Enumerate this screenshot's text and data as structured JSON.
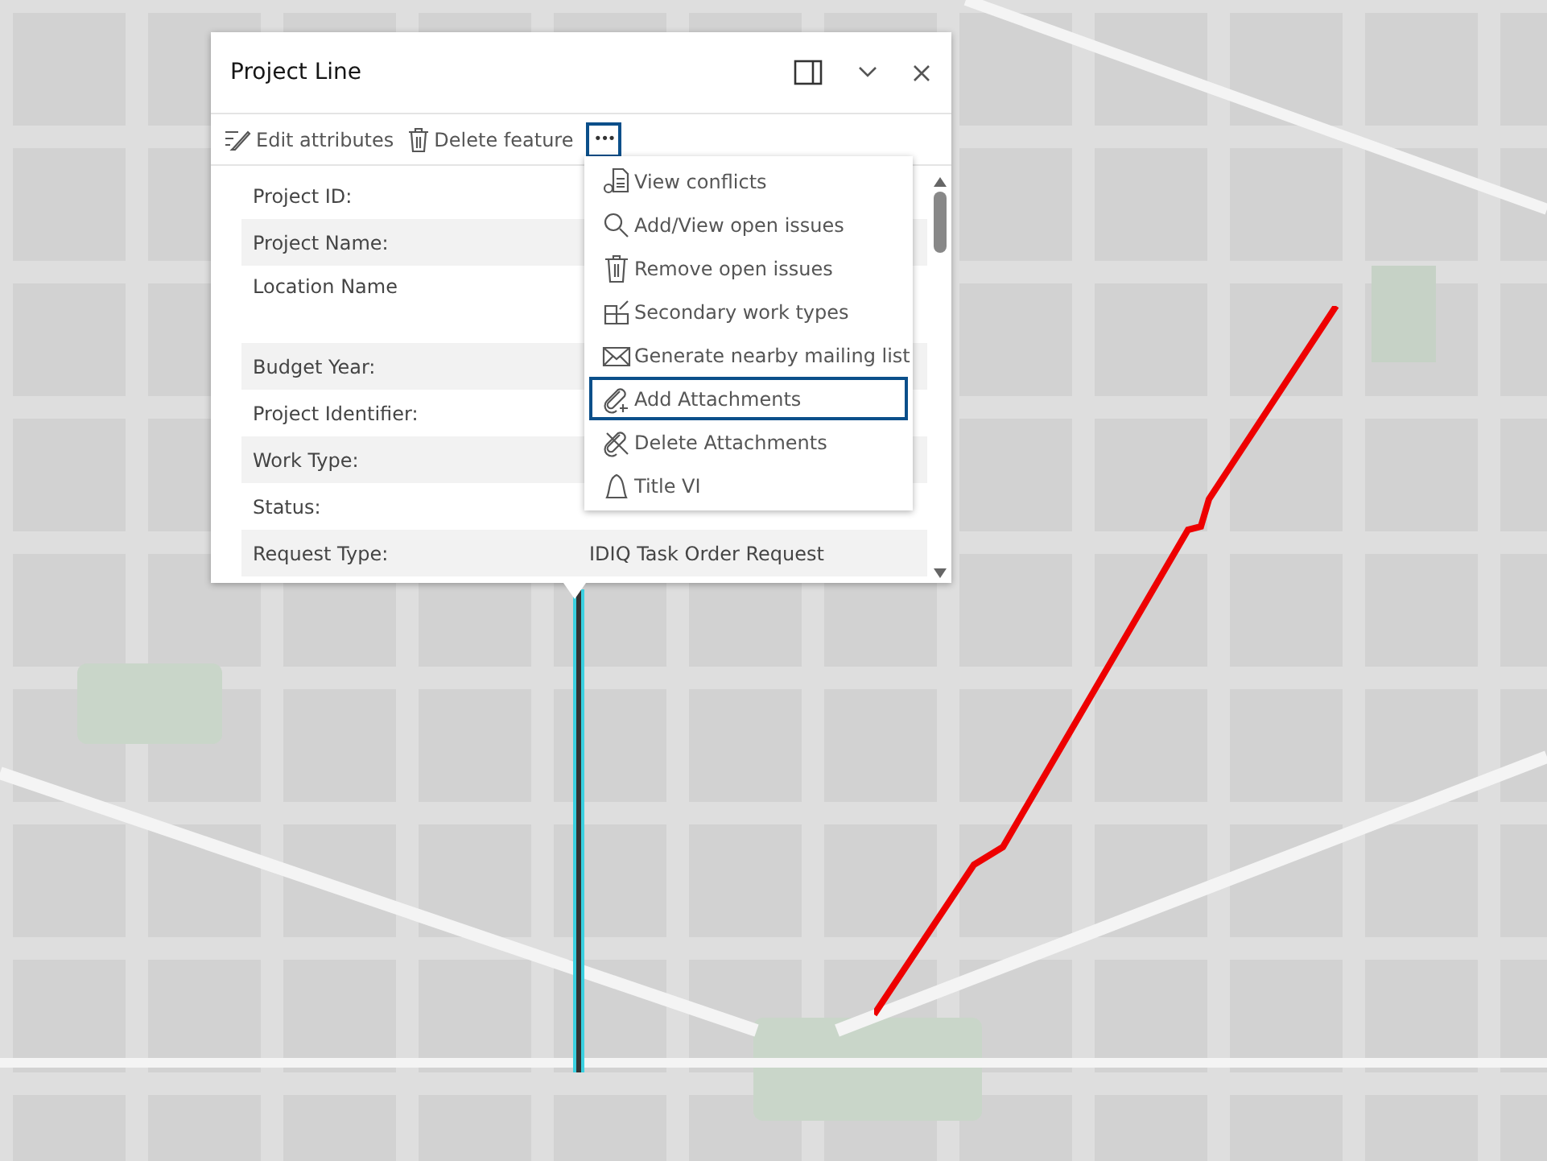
{
  "popup": {
    "title": "Project Line",
    "toolbar": [
      {
        "kind": "edit",
        "label": "Edit attributes"
      },
      {
        "kind": "delete",
        "label": "Delete feature"
      },
      {
        "kind": "more",
        "label": "•••",
        "selected": true
      }
    ],
    "fields": [
      {
        "label": "Project ID:"
      },
      {
        "label": "Project Name:"
      },
      {
        "label": "Location Name",
        "tall": true
      },
      {
        "label": "Budget Year:"
      },
      {
        "label": "Project Identifier:"
      },
      {
        "label": "Work Type:"
      },
      {
        "label": "Status:"
      },
      {
        "label": "Request Type:",
        "value": "IDIQ Task Order Request"
      }
    ],
    "menu": [
      {
        "kind": "doc",
        "label": "View conflicts",
        "selected": false
      },
      {
        "kind": "search",
        "label": "Add/View open issues",
        "selected": false
      },
      {
        "kind": "trash",
        "label": "Remove open issues",
        "selected": false
      },
      {
        "kind": "grid",
        "label": "Secondary work types",
        "selected": false
      },
      {
        "kind": "mail",
        "label": "Generate nearby mailing list",
        "selected": false
      },
      {
        "kind": "clip",
        "label": "Add Attachments",
        "selected": true
      },
      {
        "kind": "clipx",
        "label": "Delete Attachments",
        "selected": false
      },
      {
        "kind": "bell",
        "label": "Title VI",
        "selected": false
      }
    ]
  }
}
